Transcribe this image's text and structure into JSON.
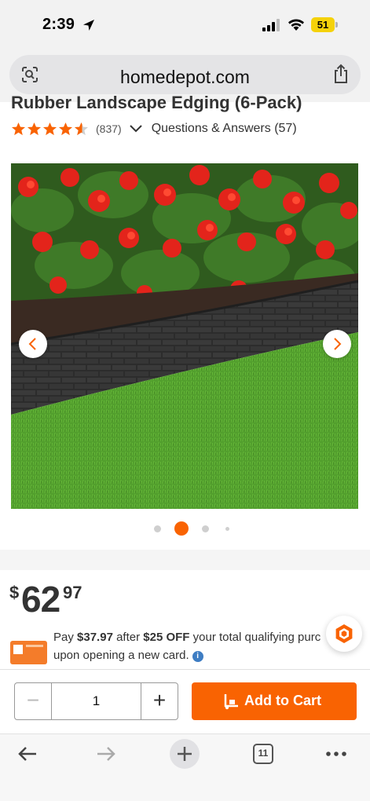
{
  "status_bar": {
    "time": "2:39",
    "battery": "51"
  },
  "browser": {
    "url": "homedepot.com",
    "tab_count": "11"
  },
  "product": {
    "title": "Rubber Landscape Edging (6-Pack)",
    "rating": 4.5,
    "review_count": "(837)",
    "qa_label": "Questions & Answers (57)"
  },
  "gallery": {
    "image_count": 4,
    "active_index": 1,
    "image_description": "product-photo"
  },
  "price": {
    "currency": "$",
    "dollars": "62",
    "cents": "97"
  },
  "offer": {
    "pay_prefix": "Pay",
    "pay_amount": "$37.97",
    "after": "after",
    "discount": "$25 OFF",
    "rest": "your total qualifying purc",
    "line2": "upon opening a new card."
  },
  "cart": {
    "quantity": "1",
    "add_to_cart_label": "Add to Cart"
  },
  "colors": {
    "brand_orange": "#f96302",
    "star": "#f96302",
    "info_blue": "#3e7dc3"
  }
}
